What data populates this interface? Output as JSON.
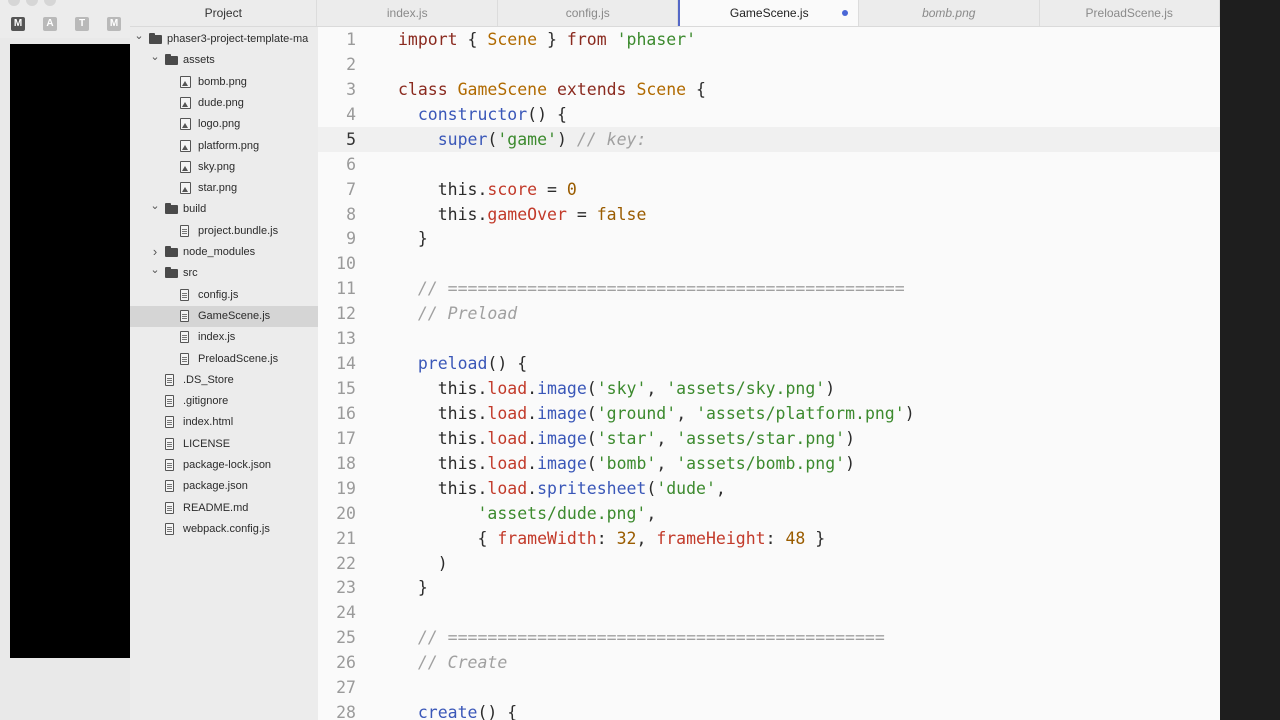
{
  "background_app": {
    "tab_letters": [
      "M",
      "A",
      "T",
      "M"
    ]
  },
  "tabs": [
    {
      "label": "Project",
      "kind": "project"
    },
    {
      "label": "index.js",
      "kind": "normal"
    },
    {
      "label": "config.js",
      "kind": "normal"
    },
    {
      "label": "GameScene.js",
      "kind": "active",
      "modified": true
    },
    {
      "label": "bomb.png",
      "kind": "italic"
    },
    {
      "label": "PreloadScene.js",
      "kind": "normal"
    }
  ],
  "tree": [
    {
      "label": "phaser3-project-template-ma",
      "type": "folder",
      "depth": 0,
      "expanded": true
    },
    {
      "label": "assets",
      "type": "folder",
      "depth": 1,
      "expanded": true
    },
    {
      "label": "bomb.png",
      "type": "image",
      "depth": 2
    },
    {
      "label": "dude.png",
      "type": "image",
      "depth": 2
    },
    {
      "label": "logo.png",
      "type": "image",
      "depth": 2
    },
    {
      "label": "platform.png",
      "type": "image",
      "depth": 2
    },
    {
      "label": "sky.png",
      "type": "image",
      "depth": 2
    },
    {
      "label": "star.png",
      "type": "image",
      "depth": 2
    },
    {
      "label": "build",
      "type": "folder",
      "depth": 1,
      "expanded": true
    },
    {
      "label": "project.bundle.js",
      "type": "file",
      "depth": 2
    },
    {
      "label": "node_modules",
      "type": "folder",
      "depth": 1,
      "expanded": false
    },
    {
      "label": "src",
      "type": "folder",
      "depth": 1,
      "expanded": true
    },
    {
      "label": "config.js",
      "type": "file",
      "depth": 2
    },
    {
      "label": "GameScene.js",
      "type": "file",
      "depth": 2,
      "selected": true
    },
    {
      "label": "index.js",
      "type": "file",
      "depth": 2
    },
    {
      "label": "PreloadScene.js",
      "type": "file",
      "depth": 2
    },
    {
      "label": ".DS_Store",
      "type": "file",
      "depth": 1
    },
    {
      "label": ".gitignore",
      "type": "file",
      "depth": 1
    },
    {
      "label": "index.html",
      "type": "file",
      "depth": 1
    },
    {
      "label": "LICENSE",
      "type": "file",
      "depth": 1
    },
    {
      "label": "package-lock.json",
      "type": "file",
      "depth": 1
    },
    {
      "label": "package.json",
      "type": "file",
      "depth": 1
    },
    {
      "label": "README.md",
      "type": "file",
      "depth": 1
    },
    {
      "label": "webpack.config.js",
      "type": "file",
      "depth": 1
    }
  ],
  "editor": {
    "current_line": 5,
    "lines": [
      [
        [
          "kw",
          "import"
        ],
        [
          "plain",
          " { "
        ],
        [
          "cls",
          "Scene"
        ],
        [
          "plain",
          " } "
        ],
        [
          "kw",
          "from"
        ],
        [
          "plain",
          " "
        ],
        [
          "str",
          "'phaser'"
        ]
      ],
      [],
      [
        [
          "kw",
          "class"
        ],
        [
          "plain",
          " "
        ],
        [
          "cls",
          "GameScene"
        ],
        [
          "plain",
          " "
        ],
        [
          "kw",
          "extends"
        ],
        [
          "plain",
          " "
        ],
        [
          "cls",
          "Scene"
        ],
        [
          "plain",
          " {"
        ]
      ],
      [
        [
          "plain",
          "  "
        ],
        [
          "fn",
          "constructor"
        ],
        [
          "plain",
          "() {"
        ]
      ],
      [
        [
          "plain",
          "    "
        ],
        [
          "fn",
          "super"
        ],
        [
          "plain",
          "("
        ],
        [
          "str",
          "'game'"
        ],
        [
          "plain",
          ") "
        ],
        [
          "cmt",
          "// key:"
        ]
      ],
      [],
      [
        [
          "plain",
          "    this."
        ],
        [
          "prop",
          "score"
        ],
        [
          "plain",
          " = "
        ],
        [
          "num",
          "0"
        ]
      ],
      [
        [
          "plain",
          "    this."
        ],
        [
          "prop",
          "gameOver"
        ],
        [
          "plain",
          " = "
        ],
        [
          "num",
          "false"
        ]
      ],
      [
        [
          "plain",
          "  }"
        ]
      ],
      [],
      [
        [
          "plain",
          "  "
        ],
        [
          "cmt",
          "// =============================================="
        ]
      ],
      [
        [
          "plain",
          "  "
        ],
        [
          "cmt",
          "// Preload"
        ]
      ],
      [],
      [
        [
          "plain",
          "  "
        ],
        [
          "fn",
          "preload"
        ],
        [
          "plain",
          "() {"
        ]
      ],
      [
        [
          "plain",
          "    this."
        ],
        [
          "prop",
          "load"
        ],
        [
          "plain",
          "."
        ],
        [
          "fn",
          "image"
        ],
        [
          "plain",
          "("
        ],
        [
          "str",
          "'sky'"
        ],
        [
          "plain",
          ", "
        ],
        [
          "str",
          "'assets/sky.png'"
        ],
        [
          "plain",
          ")"
        ]
      ],
      [
        [
          "plain",
          "    this."
        ],
        [
          "prop",
          "load"
        ],
        [
          "plain",
          "."
        ],
        [
          "fn",
          "image"
        ],
        [
          "plain",
          "("
        ],
        [
          "str",
          "'ground'"
        ],
        [
          "plain",
          ", "
        ],
        [
          "str",
          "'assets/platform.png'"
        ],
        [
          "plain",
          ")"
        ]
      ],
      [
        [
          "plain",
          "    this."
        ],
        [
          "prop",
          "load"
        ],
        [
          "plain",
          "."
        ],
        [
          "fn",
          "image"
        ],
        [
          "plain",
          "("
        ],
        [
          "str",
          "'star'"
        ],
        [
          "plain",
          ", "
        ],
        [
          "str",
          "'assets/star.png'"
        ],
        [
          "plain",
          ")"
        ]
      ],
      [
        [
          "plain",
          "    this."
        ],
        [
          "prop",
          "load"
        ],
        [
          "plain",
          "."
        ],
        [
          "fn",
          "image"
        ],
        [
          "plain",
          "("
        ],
        [
          "str",
          "'bomb'"
        ],
        [
          "plain",
          ", "
        ],
        [
          "str",
          "'assets/bomb.png'"
        ],
        [
          "plain",
          ")"
        ]
      ],
      [
        [
          "plain",
          "    this."
        ],
        [
          "prop",
          "load"
        ],
        [
          "plain",
          "."
        ],
        [
          "fn",
          "spritesheet"
        ],
        [
          "plain",
          "("
        ],
        [
          "str",
          "'dude'"
        ],
        [
          "plain",
          ","
        ]
      ],
      [
        [
          "plain",
          "        "
        ],
        [
          "str",
          "'assets/dude.png'"
        ],
        [
          "plain",
          ","
        ]
      ],
      [
        [
          "plain",
          "        { "
        ],
        [
          "prop",
          "frameWidth"
        ],
        [
          "plain",
          ": "
        ],
        [
          "num",
          "32"
        ],
        [
          "plain",
          ", "
        ],
        [
          "prop",
          "frameHeight"
        ],
        [
          "plain",
          ": "
        ],
        [
          "num",
          "48"
        ],
        [
          "plain",
          " }"
        ]
      ],
      [
        [
          "plain",
          "    )"
        ]
      ],
      [
        [
          "plain",
          "  }"
        ]
      ],
      [],
      [
        [
          "plain",
          "  "
        ],
        [
          "cmt",
          "// ============================================"
        ]
      ],
      [
        [
          "plain",
          "  "
        ],
        [
          "cmt",
          "// Create"
        ]
      ],
      [],
      [
        [
          "plain",
          "  "
        ],
        [
          "fn",
          "create"
        ],
        [
          "plain",
          "() {"
        ]
      ]
    ]
  }
}
